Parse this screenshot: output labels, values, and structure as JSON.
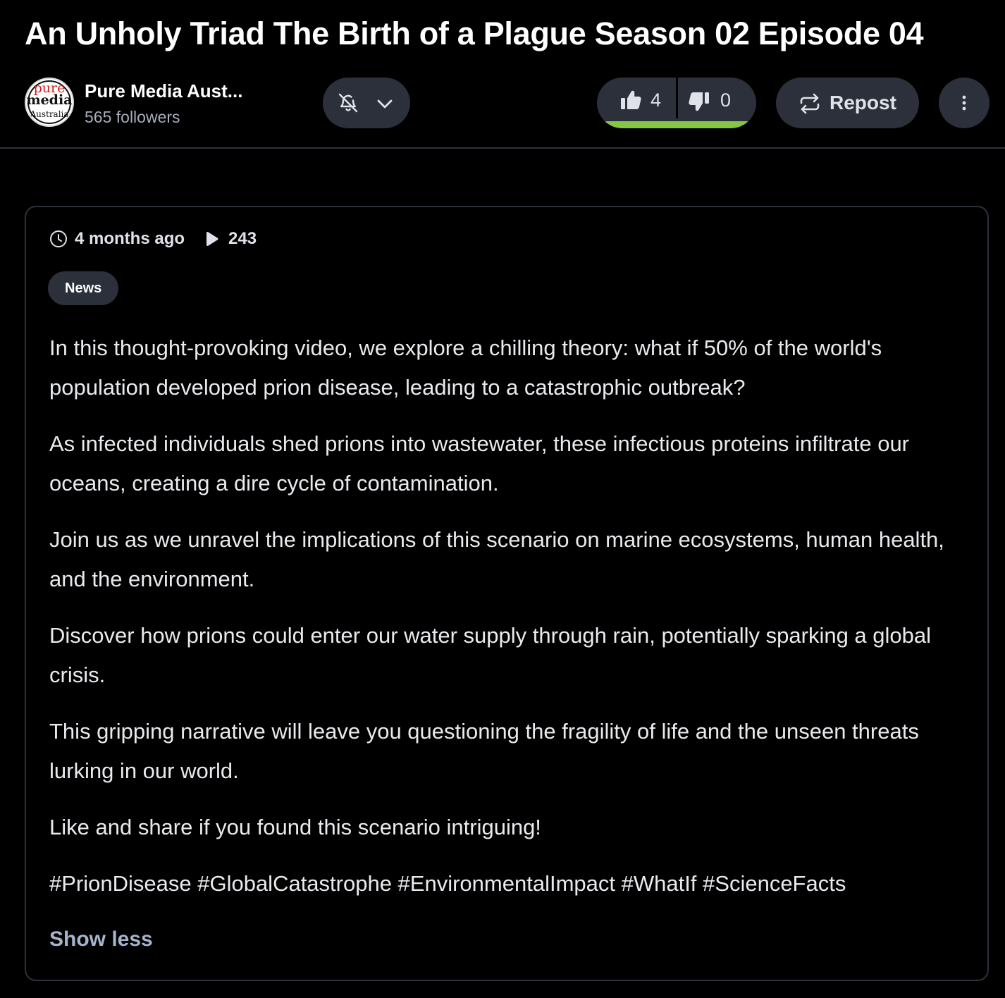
{
  "video": {
    "title": "An Unholy Triad The Birth of a Plague Season 02 Episode 04"
  },
  "channel": {
    "name": "Pure Media Aust...",
    "followers": "565 followers",
    "avatar_text": {
      "line1": "pure",
      "line2": "media",
      "line3": "Australia"
    }
  },
  "actions": {
    "notifications_icon": "bell-off-icon",
    "notifications_menu_icon": "chevron-down-icon",
    "likes": "4",
    "dislikes": "0",
    "like_ratio": 1.0,
    "repost_label": "Repost",
    "more_icon": "vertical-ellipsis-icon"
  },
  "meta": {
    "time_ago": "4 months ago",
    "views": "243",
    "category": "News"
  },
  "description": {
    "paragraphs": [
      "In this thought-provoking video, we explore a chilling theory: what if 50% of the world's population developed prion disease, leading to a catastrophic outbreak?",
      "As infected individuals shed prions into wastewater, these infectious proteins infiltrate our oceans, creating a dire cycle of contamination.",
      "Join us as we unravel the implications of this scenario on marine ecosystems, human health, and the environment.",
      "Discover how prions could enter our water supply through rain, potentially sparking a global crisis.",
      "This gripping narrative will leave you questioning the fragility of life and the unseen threats lurking in our world.",
      "Like and share if you found this scenario intriguing!",
      "#PrionDisease #GlobalCatastrophe #EnvironmentalImpact #WhatIf #ScienceFacts"
    ],
    "toggle_label": "Show less"
  },
  "colors": {
    "background": "#000000",
    "pill": "#2b303a",
    "border": "#2c313b",
    "muted_text": "#a7adbb",
    "like_bar": "#85c742",
    "link": "#a7b4cc"
  }
}
